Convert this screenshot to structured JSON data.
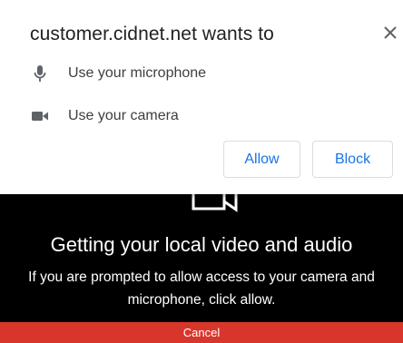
{
  "permission_prompt": {
    "title": "customer.cidnet.net wants to",
    "close_icon": "close-icon",
    "permissions": [
      {
        "icon": "microphone-icon",
        "label": "Use your microphone"
      },
      {
        "icon": "camera-icon",
        "label": "Use your camera"
      }
    ],
    "allow_label": "Allow",
    "block_label": "Block"
  },
  "video_setup": {
    "icon": "camera-outline-icon",
    "headline": "Getting your local video and audio",
    "message": "If you are prompted to allow access to your camera and microphone, click allow.",
    "cancel_label": "Cancel"
  },
  "colors": {
    "accent": "#1a73e8",
    "cancel_bar": "#d9362b",
    "background": "#000000"
  }
}
